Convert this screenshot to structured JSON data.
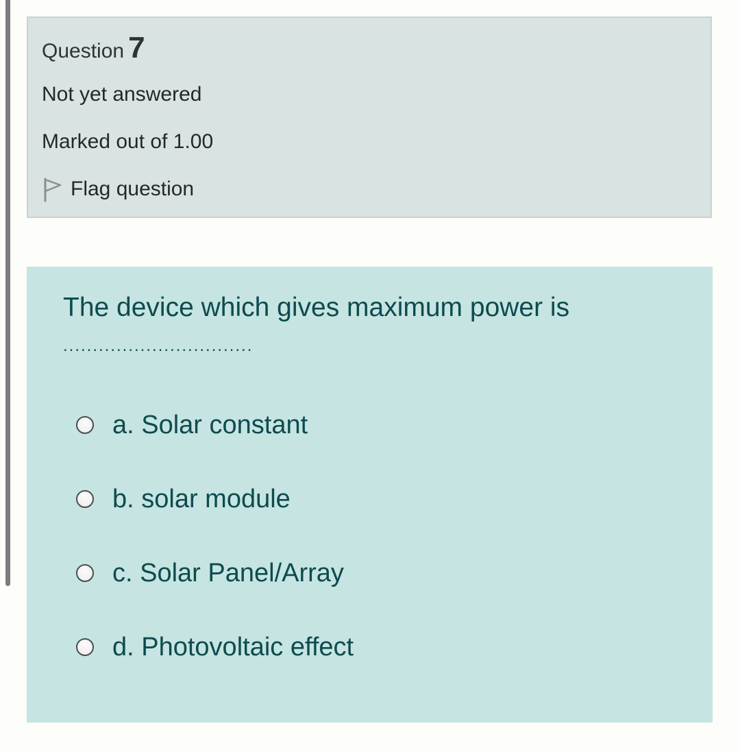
{
  "question_info": {
    "question_word": "Question",
    "question_number": "7",
    "status": "Not yet answered",
    "marks": "Marked out of 1.00",
    "flag": {
      "label": "Flag question",
      "icon": "flag-outline-icon"
    }
  },
  "question": {
    "text": "The device which gives maximum power is",
    "blank": "................................"
  },
  "answers": [
    {
      "label": "a. Solar constant",
      "selected": false
    },
    {
      "label": "b. solar module",
      "selected": false
    },
    {
      "label": "c. Solar Panel/Array",
      "selected": false
    },
    {
      "label": "d. Photovoltaic effect",
      "selected": false
    }
  ],
  "colors": {
    "info_background": "#d9e3e1",
    "question_background": "#c6e4e1",
    "question_text": "#0d4b4f",
    "info_text": "#23282b"
  }
}
